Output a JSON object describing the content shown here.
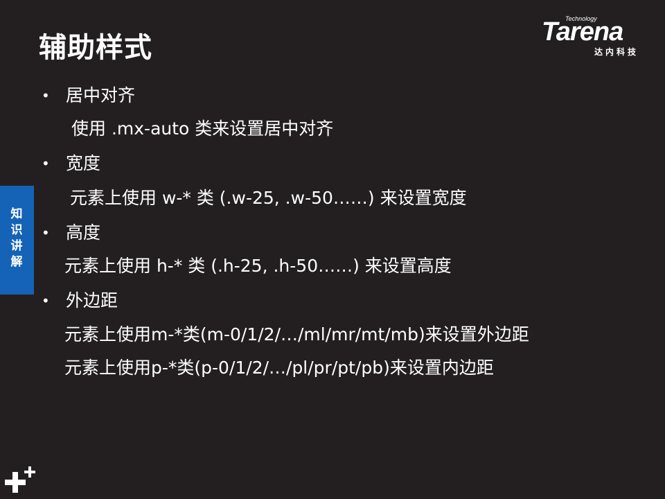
{
  "slide": {
    "title": "辅助样式",
    "side_tab_label": "知识讲解",
    "logo": {
      "tech": "Technology",
      "brand": "Tarena",
      "sub": "达内科技"
    },
    "items": [
      {
        "heading": "居中对齐",
        "lines": [
          "使用 .mx-auto 类来设置居中对齐"
        ]
      },
      {
        "heading": "宽度",
        "lines": [
          "元素上使用 w-* 类 (.w-25, .w-50……) 来设置宽度"
        ]
      },
      {
        "heading": "高度",
        "lines": [
          "元素上使用 h-* 类 (.h-25, .h-50……) 来设置高度"
        ]
      },
      {
        "heading": "外边距",
        "lines": [
          "元素上使用m-*类(m-0/1/2/…/ml/mr/mt/mb)来设置外边距",
          "元素上使用p-*类(p-0/1/2/…/pl/pr/pt/pb)来设置内边距"
        ]
      }
    ],
    "bullet_char": "•",
    "icons": {
      "corner": "plus-plus-icon"
    }
  }
}
